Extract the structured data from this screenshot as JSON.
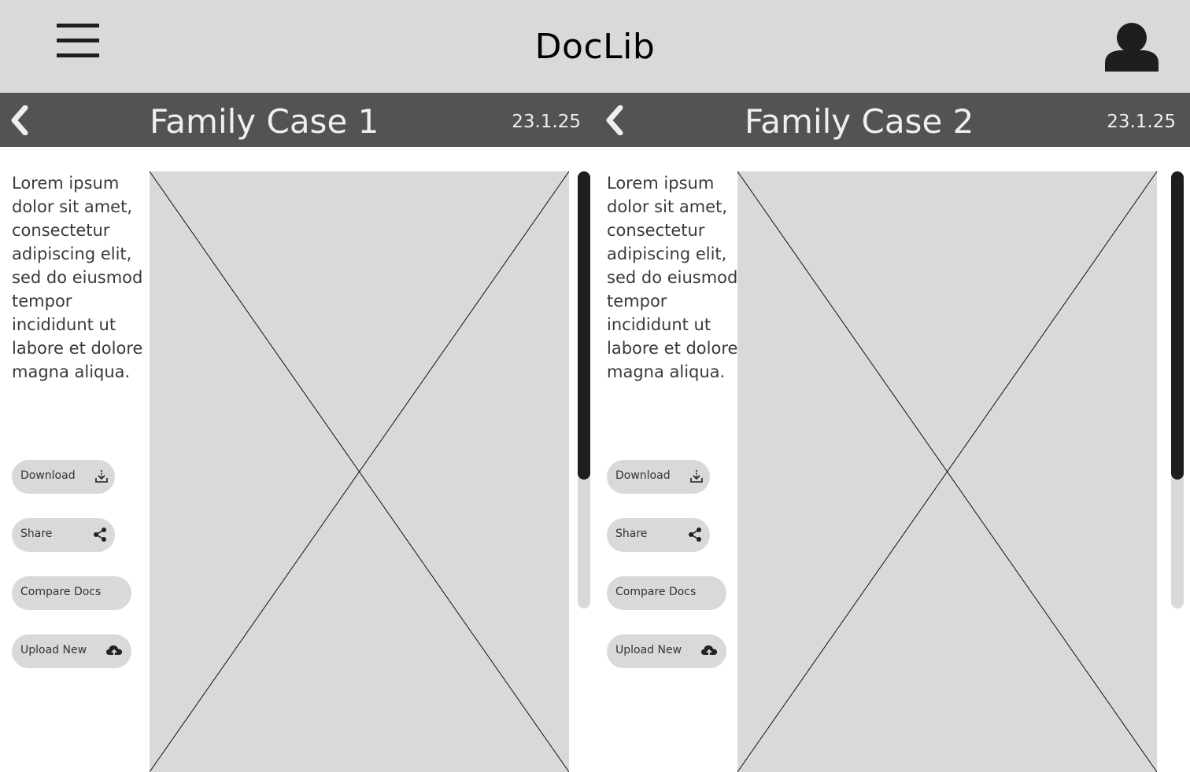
{
  "app": {
    "title": "DocLib"
  },
  "icons": {
    "menu": "hamburger-menu-icon",
    "user": "user-avatar-icon",
    "back": "chevron-left-icon",
    "download": "download-icon",
    "share": "share-icon",
    "upload": "cloud-upload-icon"
  },
  "panels": [
    {
      "title": "Family Case 1",
      "date": "23.1.25",
      "description": "Lorem ipsum dolor sit amet, consectetur adipiscing elit, sed do eiusmod tempor incididunt ut labore et dolore magna aliqua.",
      "actions": {
        "download": "Download",
        "share": "Share",
        "compare": "Compare Docs",
        "upload": "Upload New"
      }
    },
    {
      "title": "Family Case 2",
      "date": "23.1.25",
      "description": "Lorem ipsum dolor sit amet, consectetur adipiscing elit, sed do eiusmod tempor incididunt ut labore et dolore magna aliqua.",
      "actions": {
        "download": "Download",
        "share": "Share",
        "compare": "Compare Docs",
        "upload": "Upload New"
      }
    }
  ],
  "colors": {
    "appbar": "#d9d9d9",
    "casebar": "#535353",
    "placeholder": "#d9d9d9",
    "scroll_thumb": "#1e1e1e"
  }
}
